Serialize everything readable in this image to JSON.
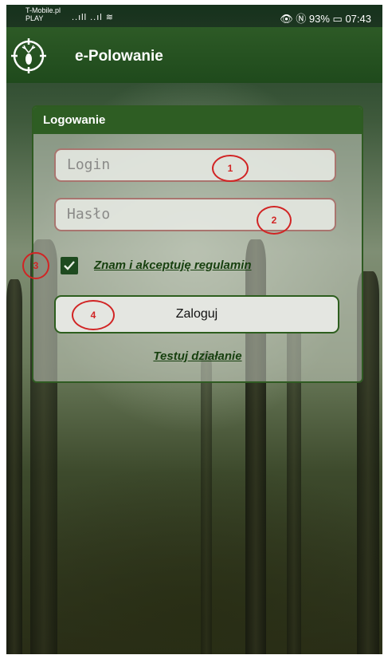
{
  "status_bar": {
    "carrier": "T-Mobile.pl",
    "carrier2": "PLAY",
    "signal": "..ıll ..ıl ≋",
    "right": "👁 Ⓝ 93% ▭ 07:43"
  },
  "app": {
    "title": "e-Polowanie"
  },
  "login_card": {
    "title": "Logowanie",
    "login_placeholder": "Login",
    "password_placeholder": "Hasło",
    "terms_label": "Znam i akceptuję regulamin",
    "terms_checked": true,
    "login_button": "Zaloguj",
    "test_link": "Testuj działanie"
  },
  "annotations": [
    "1",
    "2",
    "3",
    "4"
  ],
  "colors": {
    "primary": "#2e5d23",
    "marker": "#d12424"
  }
}
